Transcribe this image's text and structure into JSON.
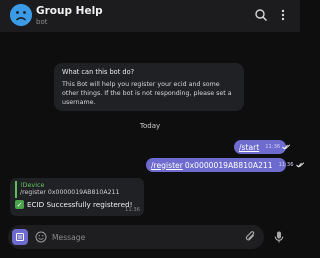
{
  "header": {
    "title": "Group Help",
    "subtitle": "bot",
    "avatar_icon": "sad-face-icon",
    "search_icon": "search-icon",
    "menu_icon": "more-vertical-icon"
  },
  "info_card": {
    "title": "What can this bot do?",
    "text": "This Bot will help you register your ecid and some other things. If the bot is not responding, please set a username."
  },
  "day_label": "Today",
  "messages": {
    "start": {
      "command": "/start",
      "time": "11:36"
    },
    "register": {
      "command": "/register",
      "argument": "0x0000019AB810A211",
      "time": "11:36"
    },
    "reply": {
      "quote_name": "!Device",
      "quote_text": "/register 0x0000019AB810A211",
      "text": "ECID Successfully registered!",
      "emoji": "check-mark-icon",
      "time": "11:36"
    }
  },
  "composer": {
    "placeholder": "Message",
    "menu_icon": "bot-menu-icon",
    "emoji_icon": "emoji-icon",
    "attach_icon": "paperclip-icon",
    "mic_icon": "microphone-icon"
  },
  "colors": {
    "accent": "#6e6bcf",
    "avatar": "#3b9be6",
    "quote": "#63c463",
    "background": "#0e0e0e"
  }
}
